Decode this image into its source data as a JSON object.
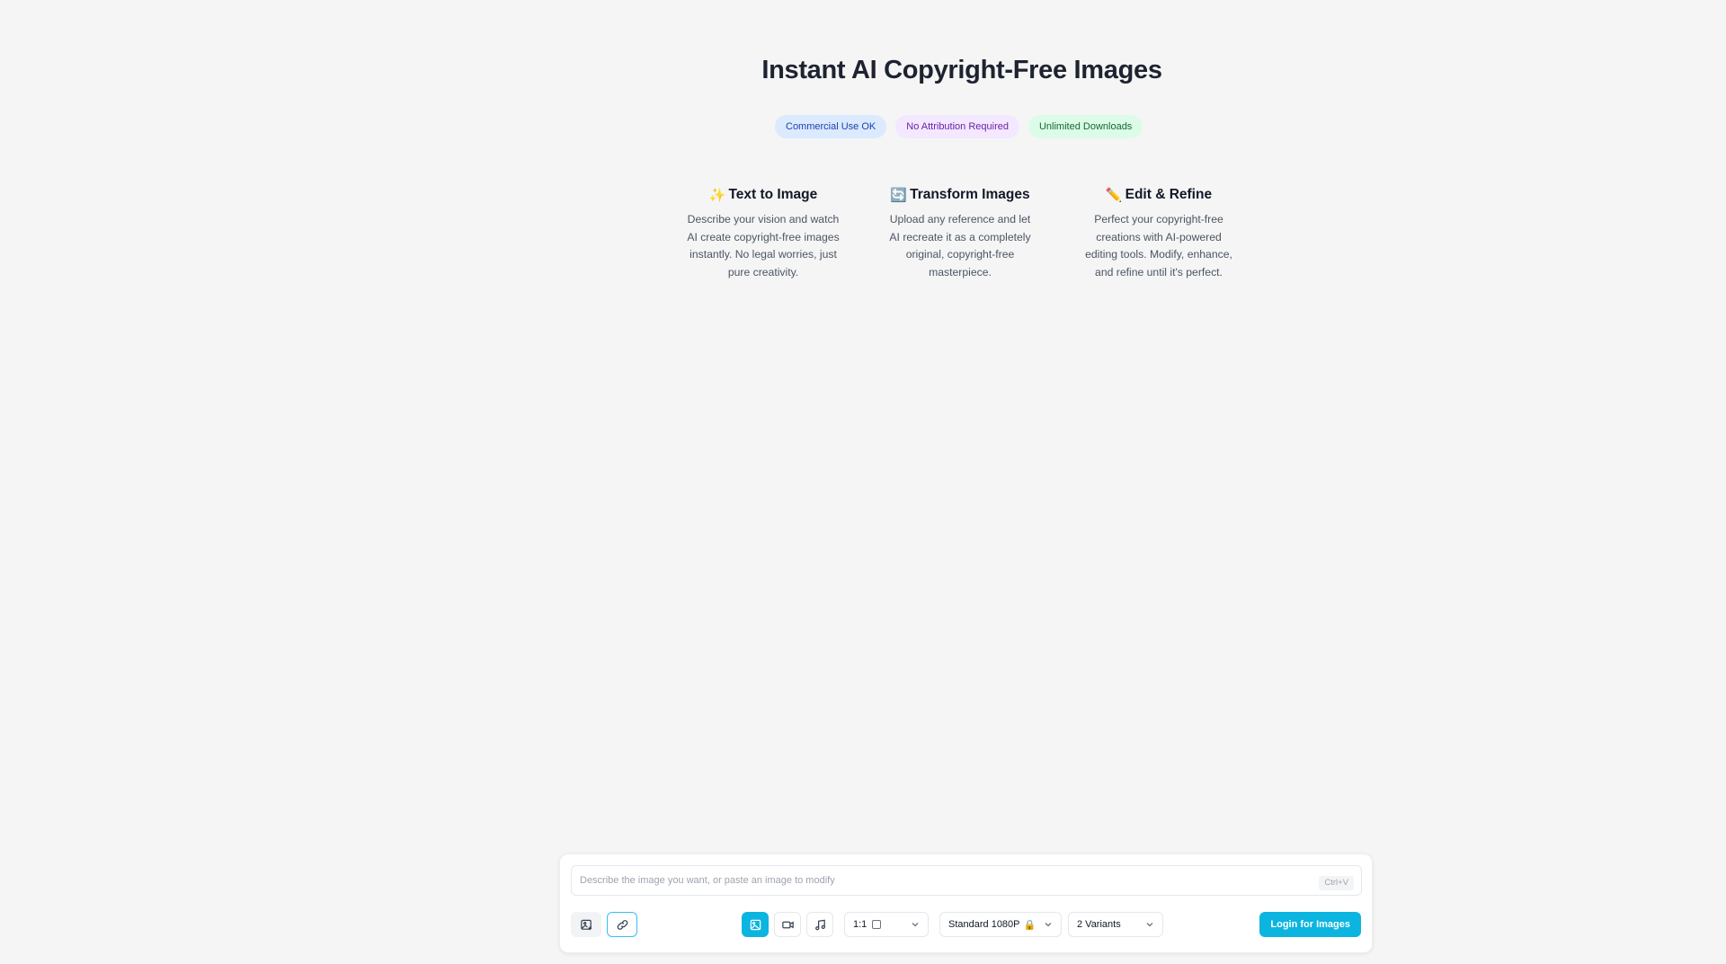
{
  "hero": {
    "title": "Instant AI Copyright-Free Images",
    "badges": [
      {
        "label": "Commercial Use OK",
        "color": "#dbeafe"
      },
      {
        "label": "No Attribution Required",
        "color": "#f3e8ff"
      },
      {
        "label": "Unlimited Downloads",
        "color": "#dcfce7"
      }
    ]
  },
  "features": [
    {
      "icon": "✨",
      "icon_name": "sparkles-icon",
      "title": "Text to Image",
      "description": "Describe your vision and watch AI create copyright-free images instantly. No legal worries, just pure creativity."
    },
    {
      "icon": "🔄",
      "icon_name": "transform-arrows-icon",
      "title": "Transform Images",
      "description": "Upload any reference and let AI recreate it as a completely original, copyright-free masterpiece."
    },
    {
      "icon": "✏️",
      "icon_name": "pencil-icon",
      "title": "Edit & Refine",
      "description": "Perfect your copyright-free creations with AI-powered editing tools. Modify, enhance, and refine until it's perfect."
    }
  ],
  "composer": {
    "placeholder": "Describe the image you want, or paste an image to modify",
    "shortcut": "Ctrl+V",
    "aspect_ratio": "1:1",
    "quality": "Standard 1080P",
    "quality_lock_icon": "🔒",
    "variants": "2 Variants",
    "login_label": "Login for Images",
    "accent_color": "#0bb5e0"
  }
}
